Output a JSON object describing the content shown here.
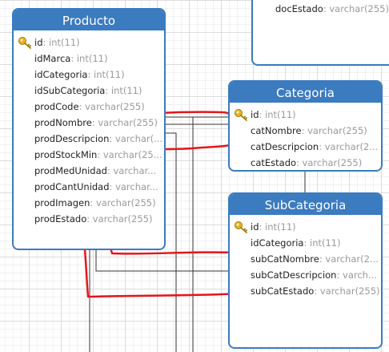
{
  "entities": {
    "producto": {
      "title": "Producto",
      "fields": [
        {
          "name": "id",
          "type": ": int(11)",
          "is_key": true
        },
        {
          "name": "idMarca",
          "type": ": int(11)"
        },
        {
          "name": "idCategoria",
          "type": ": int(11)"
        },
        {
          "name": "idSubCategoria",
          "type": ": int(11)"
        },
        {
          "name": "prodCode",
          "type": ": varchar(255)"
        },
        {
          "name": "prodNombre",
          "type": ": varchar(255)"
        },
        {
          "name": "prodDescripcion",
          "type": ": varchar(..."
        },
        {
          "name": "prodStockMin",
          "type": ": varchar(25..."
        },
        {
          "name": "prodMedUnidad",
          "type": ": varchar..."
        },
        {
          "name": "prodCantUnidad",
          "type": ": varchar..."
        },
        {
          "name": "prodImagen",
          "type": ": varchar(255)"
        },
        {
          "name": "prodEstado",
          "type": ": varchar(255)"
        }
      ]
    },
    "categoria": {
      "title": "Categoria",
      "fields": [
        {
          "name": "id",
          "type": ": int(11)",
          "is_key": true
        },
        {
          "name": "catNombre",
          "type": ": varchar(255)"
        },
        {
          "name": "catDescripcion",
          "type": ": varchar(2..."
        },
        {
          "name": "catEstado",
          "type": ": varchar(255)"
        }
      ]
    },
    "subcategoria": {
      "title": "SubCategoria",
      "fields": [
        {
          "name": "id",
          "type": ": int(11)",
          "is_key": true
        },
        {
          "name": "idCategoria",
          "type": ": int(11)"
        },
        {
          "name": "subCatNombre",
          "type": ": varchar(2..."
        },
        {
          "name": "subCatDescripcion",
          "type": ": varch..."
        },
        {
          "name": "subCatEstado",
          "type": ": varchar(255)"
        }
      ]
    },
    "doc": {
      "fields": [
        {
          "name": "docEstado",
          "type": ": varchar(255)"
        }
      ]
    }
  },
  "colors": {
    "header": "#3b7bbf",
    "annotation": "#e8141b",
    "connector": "#222222",
    "key": "#e6b422"
  }
}
